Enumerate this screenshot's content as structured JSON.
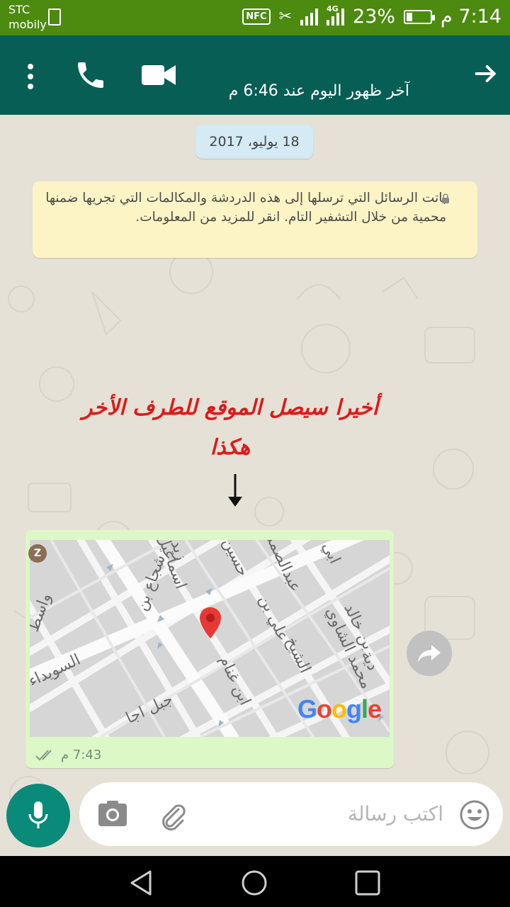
{
  "status_bar": {
    "carrier_line1": "STC",
    "carrier_line2": "mobily",
    "network": "4G",
    "battery": "23%",
    "time": "7:14 م"
  },
  "header": {
    "last_seen": "آخر ظهور اليوم عند 6:46 م",
    "icons": [
      "menu-icon",
      "phone-icon",
      "video-icon",
      "arrow-forward-icon"
    ]
  },
  "chat": {
    "date": "18 يوليو، 2017",
    "encryption_notice": "باتت الرسائل التي ترسلها إلى هذه الدردشة والمكالمات التي تجريها ضمنها محمية من خلال التشفير التام. انقر للمزيد من المعلومات.",
    "annotation_line1": "أخيرا سيصل الموقع للطرف الأخر",
    "annotation_line2": "هكذا",
    "annotation_color": "#e01818",
    "message": {
      "time": "7:43 م",
      "map_brand": "Google",
      "pin_color": "#e53935",
      "streets": [
        "اسماعيل",
        "زيد",
        "حسين",
        "عبدالصمد",
        "ابي",
        "شجاع بن",
        "علي بن",
        "الشيخ",
        "بن خالد",
        "واسط",
        "السويداء",
        "ابن غنام",
        "جبل اجا",
        "محمد الشاوي",
        "دية"
      ]
    }
  },
  "composer": {
    "placeholder": "اكتب رسالة",
    "accent": "#0a8a78"
  },
  "colors": {
    "status_bar": "#4c8a10",
    "app_bar": "#075e54",
    "bubble": "#dcf8c6",
    "notice_bg": "#fdf4c5",
    "date_bg": "#d4eaf4"
  }
}
